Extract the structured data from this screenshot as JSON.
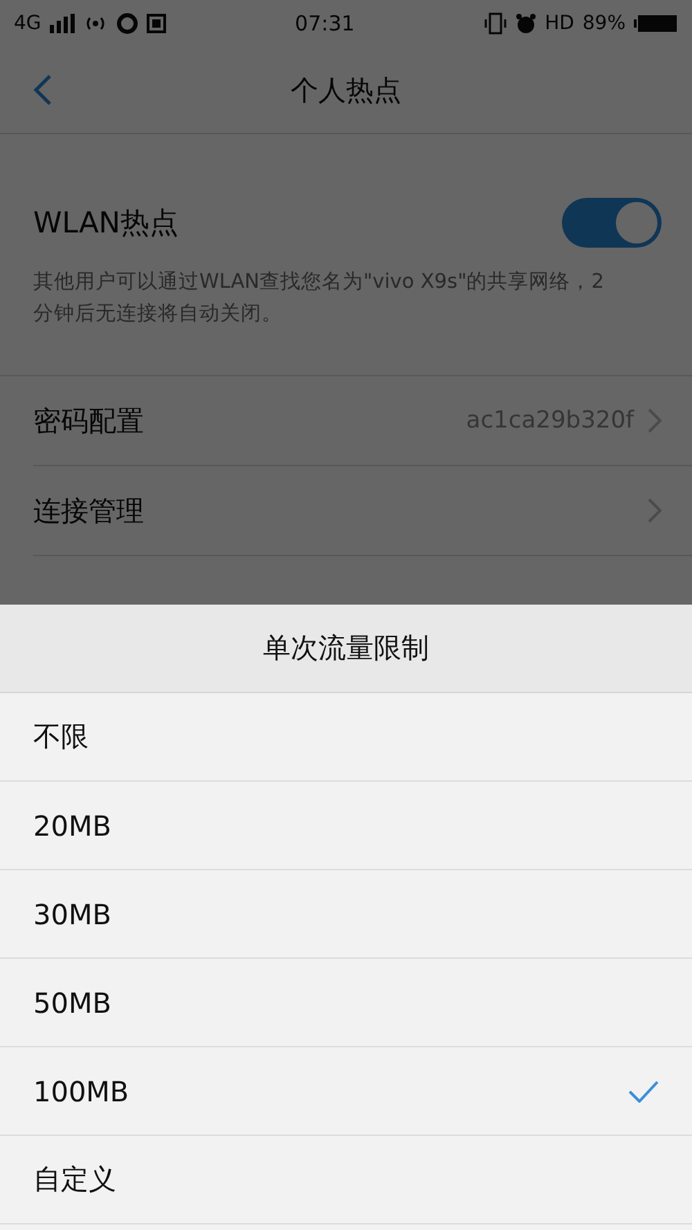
{
  "status_bar": {
    "network": "4G",
    "time": "07:31",
    "hd": "HD",
    "battery": "89%"
  },
  "header": {
    "title": "个人热点"
  },
  "hotspot": {
    "label": "WLAN热点",
    "on": true,
    "description": "其他用户可以通过WLAN查找您名为\"vivo X9s\"的共享网络，2分钟后无连接将自动关闭。"
  },
  "settings": [
    {
      "label": "密码配置",
      "value": "ac1ca29b320f"
    },
    {
      "label": "连接管理"
    }
  ],
  "sheet": {
    "title": "单次流量限制",
    "options": [
      {
        "label": "不限",
        "selected": false
      },
      {
        "label": "20MB",
        "selected": false
      },
      {
        "label": "30MB",
        "selected": false
      },
      {
        "label": "50MB",
        "selected": false
      },
      {
        "label": "100MB",
        "selected": true
      },
      {
        "label": "自定义",
        "selected": false
      }
    ]
  }
}
